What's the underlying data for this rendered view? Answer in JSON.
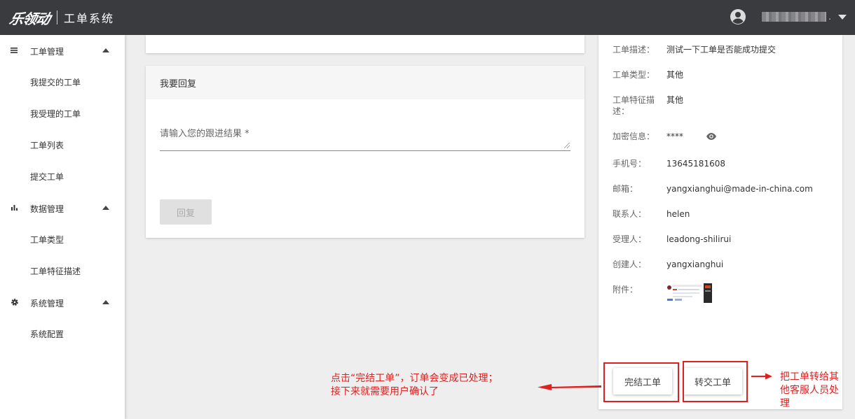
{
  "header": {
    "logo_text": "乐领动",
    "system_title": "工单系统",
    "user_name_redacted": "",
    "user_dot": "."
  },
  "sidebar": {
    "groups": [
      {
        "label": "工单管理",
        "icon": "menu-icon",
        "items": [
          "我提交的工单",
          "我受理的工单",
          "工单列表",
          "提交工单"
        ]
      },
      {
        "label": "数据管理",
        "icon": "bar-chart-icon",
        "items": [
          "工单类型",
          "工单特征描述"
        ]
      },
      {
        "label": "系统管理",
        "icon": "gear-icon",
        "items": [
          "系统配置"
        ]
      }
    ]
  },
  "reply": {
    "title": "我要回复",
    "input_label": "请输入您的跟进结果 *",
    "button_label": "回复"
  },
  "details": {
    "rows": [
      {
        "label": "工单描述：",
        "value": "测试一下工单是否能成功提交"
      },
      {
        "label": "工单类型：",
        "value": "其他"
      },
      {
        "label": "工单特征描述：",
        "value": "其他"
      },
      {
        "label": "加密信息：",
        "value": "****"
      },
      {
        "label": "手机号：",
        "value": "13645181608"
      },
      {
        "label": "邮箱：",
        "value": "yangxianghui@made-in-china.com"
      },
      {
        "label": "联系人：",
        "value": "helen"
      },
      {
        "label": "受理人：",
        "value": "leadong-shilirui"
      },
      {
        "label": "创建人：",
        "value": "yangxianghui"
      },
      {
        "label": "附件：",
        "value": ""
      }
    ],
    "finish_button": "完结工单",
    "transfer_button": "转交工单"
  },
  "annotations": {
    "left_line1": "点击“完结工单”，订单会变成已处理；",
    "left_line2": "接下来就需要用户确认了",
    "right_line1": "把工单转给其",
    "right_line2": "他客服人员处",
    "right_line3": "理"
  },
  "colors": {
    "topbar": "#3a3b3e",
    "annotation_red": "#e02020"
  }
}
